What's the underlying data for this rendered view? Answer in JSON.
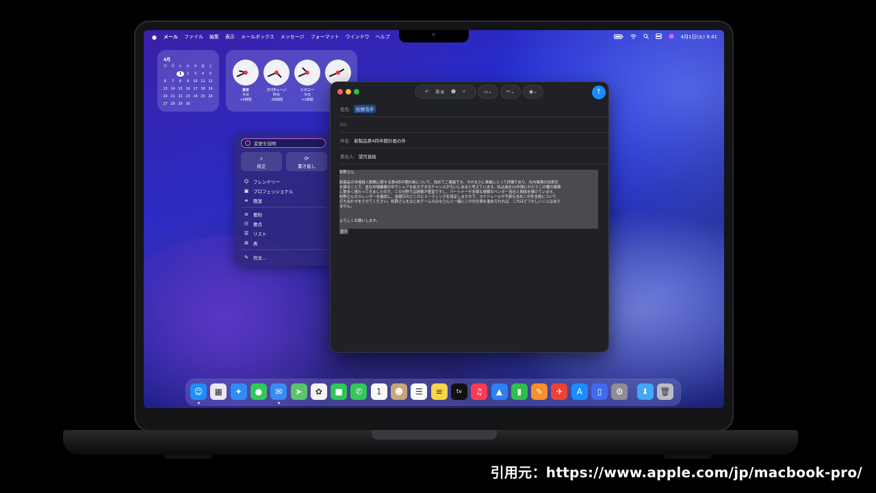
{
  "menubar": {
    "apple_icon": "apple-icon",
    "items": [
      "メール",
      "ファイル",
      "編集",
      "表示",
      "メールボックス",
      "メッセージ",
      "フォーマット",
      "ウインドウ",
      "ヘルプ"
    ],
    "datetime": "4月1日(火) 9:41"
  },
  "calendar_widget": {
    "month": "4月",
    "weekdays": [
      "日",
      "月",
      "火",
      "水",
      "木",
      "金",
      "土"
    ],
    "days": [
      "",
      "",
      "1",
      "2",
      "3",
      "4",
      "5",
      "6",
      "7",
      "8",
      "9",
      "10",
      "11",
      "12",
      "13",
      "14",
      "15",
      "16",
      "17",
      "18",
      "19",
      "20",
      "21",
      "22",
      "23",
      "24",
      "25",
      "26",
      "27",
      "28",
      "29",
      "30",
      "",
      "",
      ""
    ],
    "today": "1"
  },
  "clock_widget": {
    "clocks": [
      {
        "city": "東京",
        "day": "今日",
        "offset": "+0時間"
      },
      {
        "city": "クパティーノ",
        "day": "昨日",
        "offset": "-16時間"
      },
      {
        "city": "シドニー",
        "day": "今日",
        "offset": "+1時間"
      },
      {
        "city": "",
        "day": "",
        "offset": ""
      }
    ]
  },
  "writing_tools": {
    "describe_placeholder": "変更を説明",
    "proofread_label": "校正",
    "rewrite_label": "書き直し",
    "tones": [
      "フレンドリー",
      "プロフェッショナル",
      "簡潔"
    ],
    "formats": [
      "要約",
      "要点",
      "リスト",
      "表"
    ],
    "compose_label": "作文..."
  },
  "mail": {
    "toolbar_font_label": "あぁ",
    "to_label": "宛先:",
    "to_value": "松野浩平",
    "cc_label": "Cc:",
    "subject_label": "件名:",
    "subject_value": "新製品第4四半期計画の件",
    "from_label": "差出人:",
    "from_value": "望月直絵",
    "greeting": "松野さん",
    "body_lines": [
      "新製品の市場投入戦略に関する第4四半期計画について、改めてご連絡です。今がまさに事業にとって好機であり、社内業務の効率化",
      "を図ることで、並在市場機構の中でシェアを拡大できるチャンスが大いにあると考えています。私は過去10年間にわたりこの種の業務",
      "に数多く携わってきましたので、この分野では経験が豊富ですし、パートナーや多様な規模のベンダー各社と関係を築けています。",
      "松野さんのカレンダーを確認し、金曜日のどこかにミーティングを設定しますので、スケジュールや予算も含めこの件全般について",
      "打ち合わせをさせてください。松野さんをはじめチームのみなさんと一緒にこのお仕事を進められれば、これほどうれしいことはあり",
      "ません。"
    ],
    "closing": "よろしくお願いします。",
    "signature": "望月"
  },
  "dock": {
    "apps": [
      {
        "name": "finder-icon",
        "color": "#1e8ef5",
        "glyph": "☺"
      },
      {
        "name": "launchpad-icon",
        "color": "#e9e9ef",
        "glyph": "▦"
      },
      {
        "name": "safari-icon",
        "color": "#2f8cf5",
        "glyph": "✦"
      },
      {
        "name": "messages-icon",
        "color": "#34c759",
        "glyph": "●"
      },
      {
        "name": "mail-icon",
        "color": "#3a8cf0",
        "glyph": "✉"
      },
      {
        "name": "maps-icon",
        "color": "#5cc46a",
        "glyph": "➤"
      },
      {
        "name": "photos-icon",
        "color": "#f4f4f4",
        "glyph": "✿"
      },
      {
        "name": "facetime-icon",
        "color": "#30c65a",
        "glyph": "■"
      },
      {
        "name": "phone-icon",
        "color": "#33c759",
        "glyph": "✆"
      },
      {
        "name": "calendar-icon",
        "color": "#fafafa",
        "glyph": "1"
      },
      {
        "name": "contacts-icon",
        "color": "#c8a57a",
        "glyph": "☻"
      },
      {
        "name": "reminders-icon",
        "color": "#fafafa",
        "glyph": "☰"
      },
      {
        "name": "notes-icon",
        "color": "#f8d54a",
        "glyph": "≡"
      },
      {
        "name": "tv-icon",
        "color": "#111111",
        "glyph": "tv"
      },
      {
        "name": "music-icon",
        "color": "#fa3b55",
        "glyph": "♫"
      },
      {
        "name": "keynote-icon",
        "color": "#2d7ff5",
        "glyph": "▲"
      },
      {
        "name": "numbers-icon",
        "color": "#2fbf4a",
        "glyph": "▮"
      },
      {
        "name": "pages-icon",
        "color": "#f5902a",
        "glyph": "✎"
      },
      {
        "name": "launcher-icon",
        "color": "#ef4035",
        "glyph": "✈"
      },
      {
        "name": "app-store-icon",
        "color": "#1a8cff",
        "glyph": "A"
      },
      {
        "name": "iphone-mirroring-icon",
        "color": "#3d6cf0",
        "glyph": "▯"
      },
      {
        "name": "system-settings-icon",
        "color": "#8e8e93",
        "glyph": "⚙"
      },
      {
        "name": "downloads-folder-icon",
        "color": "#3fa9f5",
        "glyph": "⬇"
      },
      {
        "name": "trash-icon",
        "color": "#b9bcc4",
        "glyph": "🗑"
      }
    ]
  },
  "caption": "引用元：https://www.apple.com/jp/macbook-pro/"
}
